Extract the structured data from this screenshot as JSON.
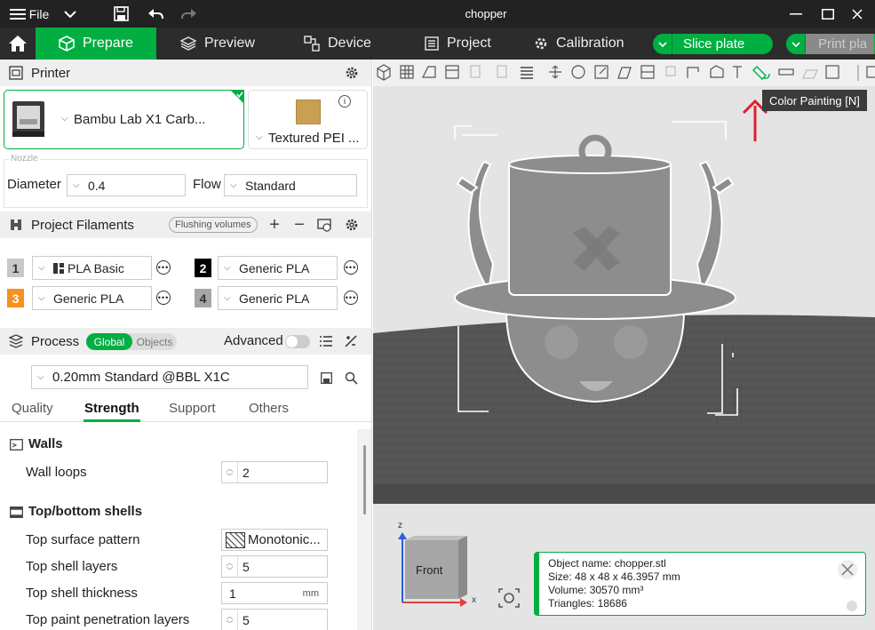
{
  "titlebar": {
    "menu_label": "File",
    "title": "chopper"
  },
  "nav": {
    "tabs": [
      {
        "label": "Prepare",
        "icon": "cube-icon"
      },
      {
        "label": "Preview",
        "icon": "layers-icon"
      },
      {
        "label": "Device",
        "icon": "device-icon"
      },
      {
        "label": "Project",
        "icon": "project-icon"
      },
      {
        "label": "Calibration",
        "icon": "calibration-icon"
      }
    ],
    "slice_label": "Slice plate",
    "print_label": "Print pla"
  },
  "printer": {
    "section_title": "Printer",
    "printer_name": "Bambu Lab X1 Carb...",
    "plate_name": "Textured PEI ...",
    "nozzle_legend": "Nozzle",
    "diameter_label": "Diameter",
    "diameter_value": "0.4",
    "flow_label": "Flow",
    "flow_value": "Standard"
  },
  "filaments": {
    "section_title": "Project Filaments",
    "flushing_label": "Flushing volumes",
    "items": [
      {
        "num": "1",
        "name": "PLA Basic",
        "color": "#c8c8c8",
        "num_color": "#333"
      },
      {
        "num": "2",
        "name": "Generic PLA",
        "color": "#000000",
        "num_color": "#fff"
      },
      {
        "num": "3",
        "name": "Generic PLA",
        "color": "#f7901e",
        "num_color": "#fff"
      },
      {
        "num": "4",
        "name": "Generic PLA",
        "color": "#a6a6a6",
        "num_color": "#333"
      }
    ]
  },
  "process": {
    "section_title": "Process",
    "toggle_global": "Global",
    "toggle_objects": "Objects",
    "advanced_label": "Advanced",
    "preset": "0.20mm Standard @BBL X1C",
    "tabs": [
      "Quality",
      "Strength",
      "Support",
      "Others"
    ],
    "active_tab": "Strength",
    "walls_title": "Walls",
    "wall_loops_label": "Wall loops",
    "wall_loops_value": "2",
    "shells_title": "Top/bottom shells",
    "top_pattern_label": "Top surface pattern",
    "top_pattern_value": "Monotonic...",
    "top_layers_label": "Top shell layers",
    "top_layers_value": "5",
    "top_thickness_label": "Top shell thickness",
    "top_thickness_value": "1",
    "top_thickness_unit": "mm",
    "top_paint_label": "Top paint penetration layers",
    "top_paint_value": "5"
  },
  "viewport": {
    "tooltip": "Color Painting [N]",
    "cube_label": "Front",
    "axis_z": "z",
    "axis_x": "x",
    "info": {
      "name": "Object name: chopper.stl",
      "size": "Size: 48 x 48 x 46.3957 mm",
      "volume": "Volume: 30570 mm³",
      "triangles": "Triangles: 18686"
    }
  },
  "colors": {
    "accent": "#00ae42",
    "titlebar": "#222222",
    "navbar": "#2c2c2c"
  }
}
